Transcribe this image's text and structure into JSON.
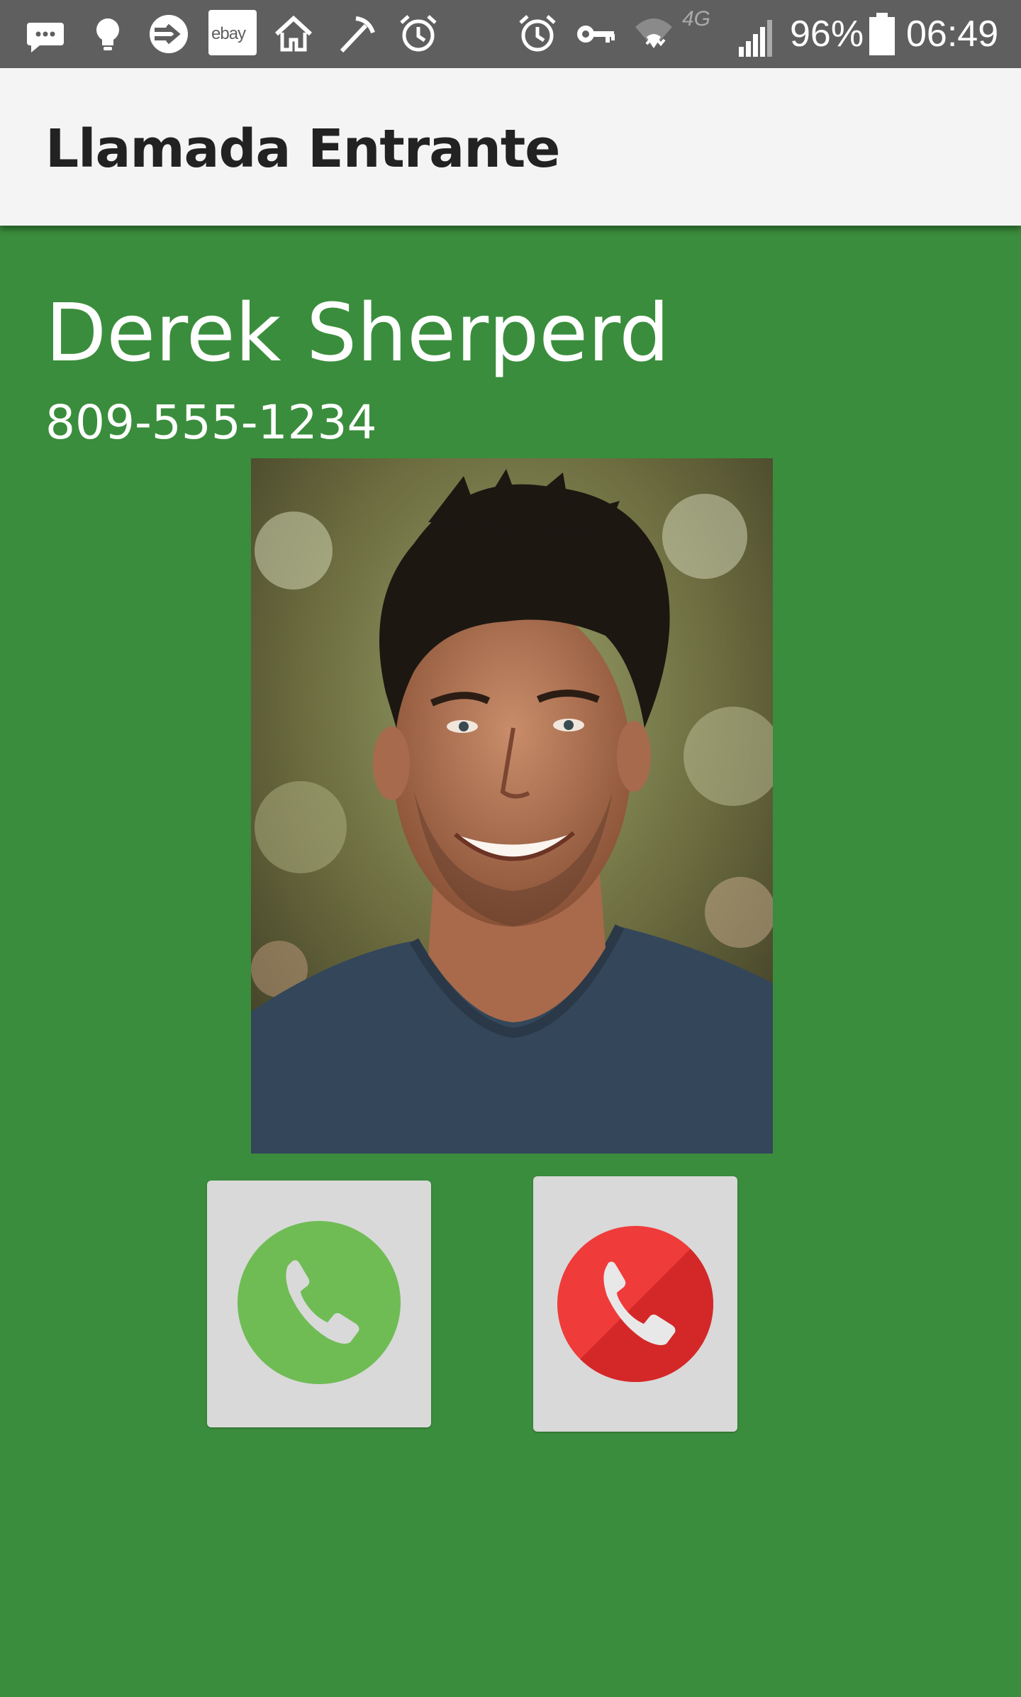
{
  "status_bar": {
    "icons": [
      "messages-icon",
      "lightbulb-icon",
      "vpn-icon",
      "ebay-icon",
      "home-icon",
      "tools-icon",
      "alarm-icon",
      "alarm-icon",
      "key-icon",
      "wifi-icon",
      "lte-icon",
      "signal-icon",
      "battery-icon"
    ],
    "ebay_label": "ebay",
    "lte_label": "4G",
    "battery": "96%",
    "time": "06:49"
  },
  "app_bar": {
    "title": "Llamada Entrante"
  },
  "caller": {
    "name": "Derek Sherperd",
    "number": "809-555-1234",
    "photo_icon": "caller-photo"
  },
  "actions": {
    "accept_icon": "accept-call-icon",
    "decline_icon": "decline-call-icon"
  },
  "colors": {
    "background": "#3a8d3c",
    "status_bar": "#5f5f5f",
    "app_bar": "#f4f4f4",
    "accept": "#6fbc55",
    "decline": "#e83232",
    "button_bg": "#d9d9d9"
  }
}
